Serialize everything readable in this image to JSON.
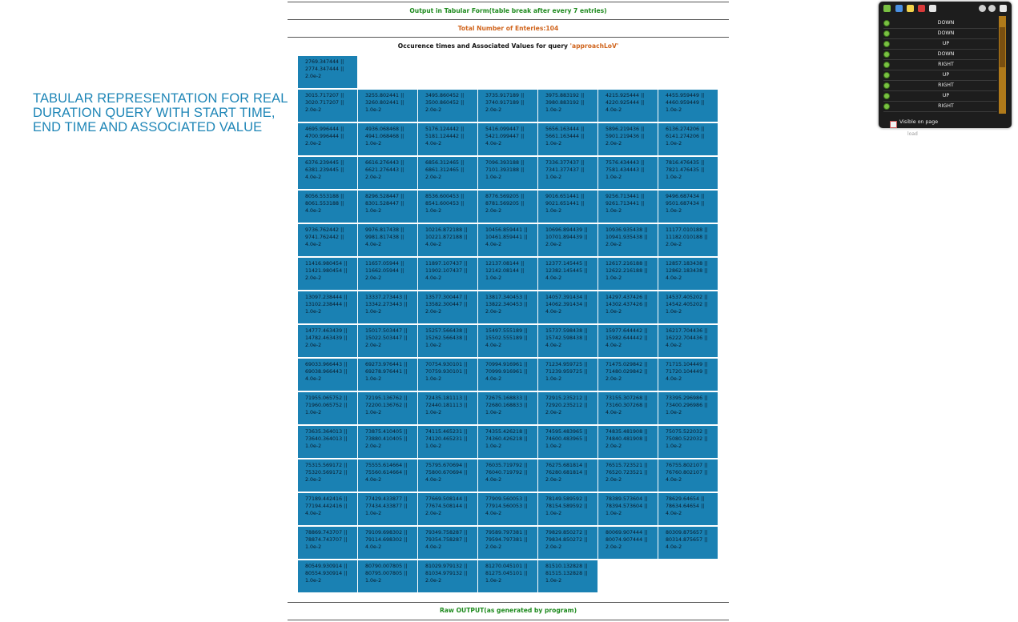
{
  "side_title": "TABULAR REPRESENTATION FOR REAL DURATION QUERY WITH START TIME, END TIME AND ASSOCIATED VALUE",
  "header": {
    "output_title": "Output in Tabular Form(table break after every 7 entries)",
    "total_entries": "Total Number of Enteries:104",
    "occurrence_prefix": "Occurence times and Associated Values for query ",
    "query_name": "'approachLoV'"
  },
  "grid_rows": [
    [
      {
        "s": "2769.347444 ||",
        "e": "2774.347444 ||",
        "v": "2.0e-2"
      }
    ],
    [
      {
        "s": "3015.717207 ||",
        "e": "3020.717207 ||",
        "v": "2.0e-2"
      },
      {
        "s": "3255.802441 ||",
        "e": "3260.802441 ||",
        "v": "1.0e-2"
      },
      {
        "s": "3495.860452 ||",
        "e": "3500.860452 ||",
        "v": "2.0e-2"
      },
      {
        "s": "3735.917189 ||",
        "e": "3740.917189 ||",
        "v": "2.0e-2"
      },
      {
        "s": "3975.883192 ||",
        "e": "3980.883192 ||",
        "v": "1.0e-2"
      },
      {
        "s": "4215.925444 ||",
        "e": "4220.925444 ||",
        "v": "4.0e-2"
      },
      {
        "s": "4455.959449 ||",
        "e": "4460.959449 ||",
        "v": "1.0e-2"
      }
    ],
    [
      {
        "s": "4695.996444 ||",
        "e": "4700.996444 ||",
        "v": "2.0e-2"
      },
      {
        "s": "4936.068468 ||",
        "e": "4941.068468 ||",
        "v": "1.0e-2"
      },
      {
        "s": "5176.124442 ||",
        "e": "5181.124442 ||",
        "v": "4.0e-2"
      },
      {
        "s": "5416.099447 ||",
        "e": "5421.099447 ||",
        "v": "4.0e-2"
      },
      {
        "s": "5656.163444 ||",
        "e": "5661.163444 ||",
        "v": "1.0e-2"
      },
      {
        "s": "5896.219436 ||",
        "e": "5901.219436 ||",
        "v": "2.0e-2"
      },
      {
        "s": "6136.274206 ||",
        "e": "6141.274206 ||",
        "v": "1.0e-2"
      }
    ],
    [
      {
        "s": "6376.239445 ||",
        "e": "6381.239445 ||",
        "v": "4.0e-2"
      },
      {
        "s": "6616.276443 ||",
        "e": "6621.276443 ||",
        "v": "2.0e-2"
      },
      {
        "s": "6856.312465 ||",
        "e": "6861.312465 ||",
        "v": "2.0e-2"
      },
      {
        "s": "7096.393188 ||",
        "e": "7101.393188 ||",
        "v": "1.0e-2"
      },
      {
        "s": "7336.377437 ||",
        "e": "7341.377437 ||",
        "v": "1.0e-2"
      },
      {
        "s": "7576.434443 ||",
        "e": "7581.434443 ||",
        "v": "1.0e-2"
      },
      {
        "s": "7816.476435 ||",
        "e": "7821.476435 ||",
        "v": "1.0e-2"
      }
    ],
    [
      {
        "s": "8056.553188 ||",
        "e": "8061.553188 ||",
        "v": "4.0e-2"
      },
      {
        "s": "8296.528447 ||",
        "e": "8301.528447 ||",
        "v": "1.0e-2"
      },
      {
        "s": "8536.600453 ||",
        "e": "8541.600453 ||",
        "v": "1.0e-2"
      },
      {
        "s": "8776.569205 ||",
        "e": "8781.569205 ||",
        "v": "2.0e-2"
      },
      {
        "s": "9016.651441 ||",
        "e": "9021.651441 ||",
        "v": "1.0e-2"
      },
      {
        "s": "9256.713441 ||",
        "e": "9261.713441 ||",
        "v": "1.0e-2"
      },
      {
        "s": "9496.687434 ||",
        "e": "9501.687434 ||",
        "v": "1.0e-2"
      }
    ],
    [
      {
        "s": "9736.762442 ||",
        "e": "9741.762442 ||",
        "v": "4.0e-2"
      },
      {
        "s": "9976.817438 ||",
        "e": "9981.817438 ||",
        "v": "4.0e-2"
      },
      {
        "s": "10216.872188 ||",
        "e": "10221.872188 ||",
        "v": "4.0e-2"
      },
      {
        "s": "10456.859441 ||",
        "e": "10461.859441 ||",
        "v": "4.0e-2"
      },
      {
        "s": "10696.894439 ||",
        "e": "10701.894439 ||",
        "v": "2.0e-2"
      },
      {
        "s": "10936.935438 ||",
        "e": "10941.935438 ||",
        "v": "2.0e-2"
      },
      {
        "s": "11177.010188 ||",
        "e": "11182.010188 ||",
        "v": "2.0e-2"
      }
    ],
    [
      {
        "s": "11416.980454 ||",
        "e": "11421.980454 ||",
        "v": "2.0e-2"
      },
      {
        "s": "11657.05944 ||",
        "e": "11662.05944 ||",
        "v": "2.0e-2"
      },
      {
        "s": "11897.107437 ||",
        "e": "11902.107437 ||",
        "v": "4.0e-2"
      },
      {
        "s": "12137.08144 ||",
        "e": "12142.08144 ||",
        "v": "1.0e-2"
      },
      {
        "s": "12377.145445 ||",
        "e": "12382.145445 ||",
        "v": "4.0e-2"
      },
      {
        "s": "12617.216188 ||",
        "e": "12622.216188 ||",
        "v": "1.0e-2"
      },
      {
        "s": "12857.183438 ||",
        "e": "12862.183438 ||",
        "v": "4.0e-2"
      }
    ],
    [
      {
        "s": "13097.238444 ||",
        "e": "13102.238444 ||",
        "v": "1.0e-2"
      },
      {
        "s": "13337.273443 ||",
        "e": "13342.273443 ||",
        "v": "1.0e-2"
      },
      {
        "s": "13577.300447 ||",
        "e": "13582.300447 ||",
        "v": "2.0e-2"
      },
      {
        "s": "13817.340453 ||",
        "e": "13822.340453 ||",
        "v": "2.0e-2"
      },
      {
        "s": "14057.391434 ||",
        "e": "14062.391434 ||",
        "v": "4.0e-2"
      },
      {
        "s": "14297.437426 ||",
        "e": "14302.437426 ||",
        "v": "1.0e-2"
      },
      {
        "s": "14537.405202 ||",
        "e": "14542.405202 ||",
        "v": "1.0e-2"
      }
    ],
    [
      {
        "s": "14777.463439 ||",
        "e": "14782.463439 ||",
        "v": "2.0e-2"
      },
      {
        "s": "15017.503447 ||",
        "e": "15022.503447 ||",
        "v": "2.0e-2"
      },
      {
        "s": "15257.566438 ||",
        "e": "15262.566438 ||",
        "v": "1.0e-2"
      },
      {
        "s": "15497.555189 ||",
        "e": "15502.555189 ||",
        "v": "4.0e-2"
      },
      {
        "s": "15737.598438 ||",
        "e": "15742.598438 ||",
        "v": "4.0e-2"
      },
      {
        "s": "15977.644442 ||",
        "e": "15982.644442 ||",
        "v": "4.0e-2"
      },
      {
        "s": "16217.704436 ||",
        "e": "16222.704436 ||",
        "v": "4.0e-2"
      }
    ],
    [
      {
        "s": "69033.966443 ||",
        "e": "69038.966443 ||",
        "v": "4.0e-2"
      },
      {
        "s": "69273.976441 ||",
        "e": "69278.976441 ||",
        "v": "1.0e-2"
      },
      {
        "s": "70754.930101 ||",
        "e": "70759.930101 ||",
        "v": "1.0e-2"
      },
      {
        "s": "70994.916961 ||",
        "e": "70999.916961 ||",
        "v": "4.0e-2"
      },
      {
        "s": "71234.959725 ||",
        "e": "71239.959725 ||",
        "v": "1.0e-2"
      },
      {
        "s": "71475.029842 ||",
        "e": "71480.029842 ||",
        "v": "2.0e-2"
      },
      {
        "s": "71715.104449 ||",
        "e": "71720.104449 ||",
        "v": "4.0e-2"
      }
    ],
    [
      {
        "s": "71955.065752 ||",
        "e": "71960.065752 ||",
        "v": "1.0e-2"
      },
      {
        "s": "72195.136762 ||",
        "e": "72200.136762 ||",
        "v": "1.0e-2"
      },
      {
        "s": "72435.181113 ||",
        "e": "72440.181113 ||",
        "v": "1.0e-2"
      },
      {
        "s": "72675.168833 ||",
        "e": "72680.168833 ||",
        "v": "1.0e-2"
      },
      {
        "s": "72915.235212 ||",
        "e": "72920.235212 ||",
        "v": "2.0e-2"
      },
      {
        "s": "73155.307268 ||",
        "e": "73160.307268 ||",
        "v": "4.0e-2"
      },
      {
        "s": "73395.296986 ||",
        "e": "73400.296986 ||",
        "v": "1.0e-2"
      }
    ],
    [
      {
        "s": "73635.364013 ||",
        "e": "73640.364013 ||",
        "v": "1.0e-2"
      },
      {
        "s": "73875.410405 ||",
        "e": "73880.410405 ||",
        "v": "2.0e-2"
      },
      {
        "s": "74115.465231 ||",
        "e": "74120.465231 ||",
        "v": "1.0e-2"
      },
      {
        "s": "74355.426218 ||",
        "e": "74360.426218 ||",
        "v": "1.0e-2"
      },
      {
        "s": "74595.483965 ||",
        "e": "74600.483965 ||",
        "v": "1.0e-2"
      },
      {
        "s": "74835.481908 ||",
        "e": "74840.481908 ||",
        "v": "2.0e-2"
      },
      {
        "s": "75075.522032 ||",
        "e": "75080.522032 ||",
        "v": "1.0e-2"
      }
    ],
    [
      {
        "s": "75315.569172 ||",
        "e": "75320.569172 ||",
        "v": "2.0e-2"
      },
      {
        "s": "75555.614664 ||",
        "e": "75560.614664 ||",
        "v": "4.0e-2"
      },
      {
        "s": "75795.670694 ||",
        "e": "75800.670694 ||",
        "v": "4.0e-2"
      },
      {
        "s": "76035.719792 ||",
        "e": "76040.719792 ||",
        "v": "4.0e-2"
      },
      {
        "s": "76275.681814 ||",
        "e": "76280.681814 ||",
        "v": "2.0e-2"
      },
      {
        "s": "76515.723521 ||",
        "e": "76520.723521 ||",
        "v": "2.0e-2"
      },
      {
        "s": "76755.802107 ||",
        "e": "76760.802107 ||",
        "v": "4.0e-2"
      }
    ],
    [
      {
        "s": "77189.442416 ||",
        "e": "77194.442416 ||",
        "v": "4.0e-2"
      },
      {
        "s": "77429.433877 ||",
        "e": "77434.433877 ||",
        "v": "1.0e-2"
      },
      {
        "s": "77669.508144 ||",
        "e": "77674.508144 ||",
        "v": "2.0e-2"
      },
      {
        "s": "77909.560053 ||",
        "e": "77914.560053 ||",
        "v": "4.0e-2"
      },
      {
        "s": "78149.589592 ||",
        "e": "78154.589592 ||",
        "v": "1.0e-2"
      },
      {
        "s": "78389.573604 ||",
        "e": "78394.573604 ||",
        "v": "1.0e-2"
      },
      {
        "s": "78629.64654 ||",
        "e": "78634.64654 ||",
        "v": "4.0e-2"
      }
    ],
    [
      {
        "s": "78869.743707 ||",
        "e": "78874.743707 ||",
        "v": "1.0e-2"
      },
      {
        "s": "79109.698302 ||",
        "e": "79114.698302 ||",
        "v": "4.0e-2"
      },
      {
        "s": "79349.758287 ||",
        "e": "79354.758287 ||",
        "v": "4.0e-2"
      },
      {
        "s": "79589.797381 ||",
        "e": "79594.797381 ||",
        "v": "2.0e-2"
      },
      {
        "s": "79829.850272 ||",
        "e": "79834.850272 ||",
        "v": "2.0e-2"
      },
      {
        "s": "80069.907444 ||",
        "e": "80074.907444 ||",
        "v": "2.0e-2"
      },
      {
        "s": "80309.875657 ||",
        "e": "80314.875657 ||",
        "v": "4.0e-2"
      }
    ],
    [
      {
        "s": "80549.930914 ||",
        "e": "80554.930914 ||",
        "v": "1.0e-2"
      },
      {
        "s": "80790.007805 ||",
        "e": "80795.007805 ||",
        "v": "1.0e-2"
      },
      {
        "s": "81029.979132 ||",
        "e": "81034.979132 ||",
        "v": "2.0e-2"
      },
      {
        "s": "81270.045101 ||",
        "e": "81275.045101 ||",
        "v": "1.0e-2"
      },
      {
        "s": "81510.132828 ||",
        "e": "81515.132828 ||",
        "v": "1.0e-2"
      }
    ]
  ],
  "raw_output_title": "Raw OUTPUT(as generated by program)",
  "widget": {
    "items": [
      "DOWN",
      "DOWN",
      "UP",
      "DOWN",
      "RIGHT",
      "UP",
      "RIGHT",
      "UP",
      "RIGHT"
    ],
    "visible_label": "Visible on page",
    "below_label": "load"
  },
  "colors": {
    "cell_bg": "#1a81b3",
    "title_blue": "#1f86b7",
    "green_text": "#1d8a1d",
    "orange_text": "#d0641c"
  }
}
